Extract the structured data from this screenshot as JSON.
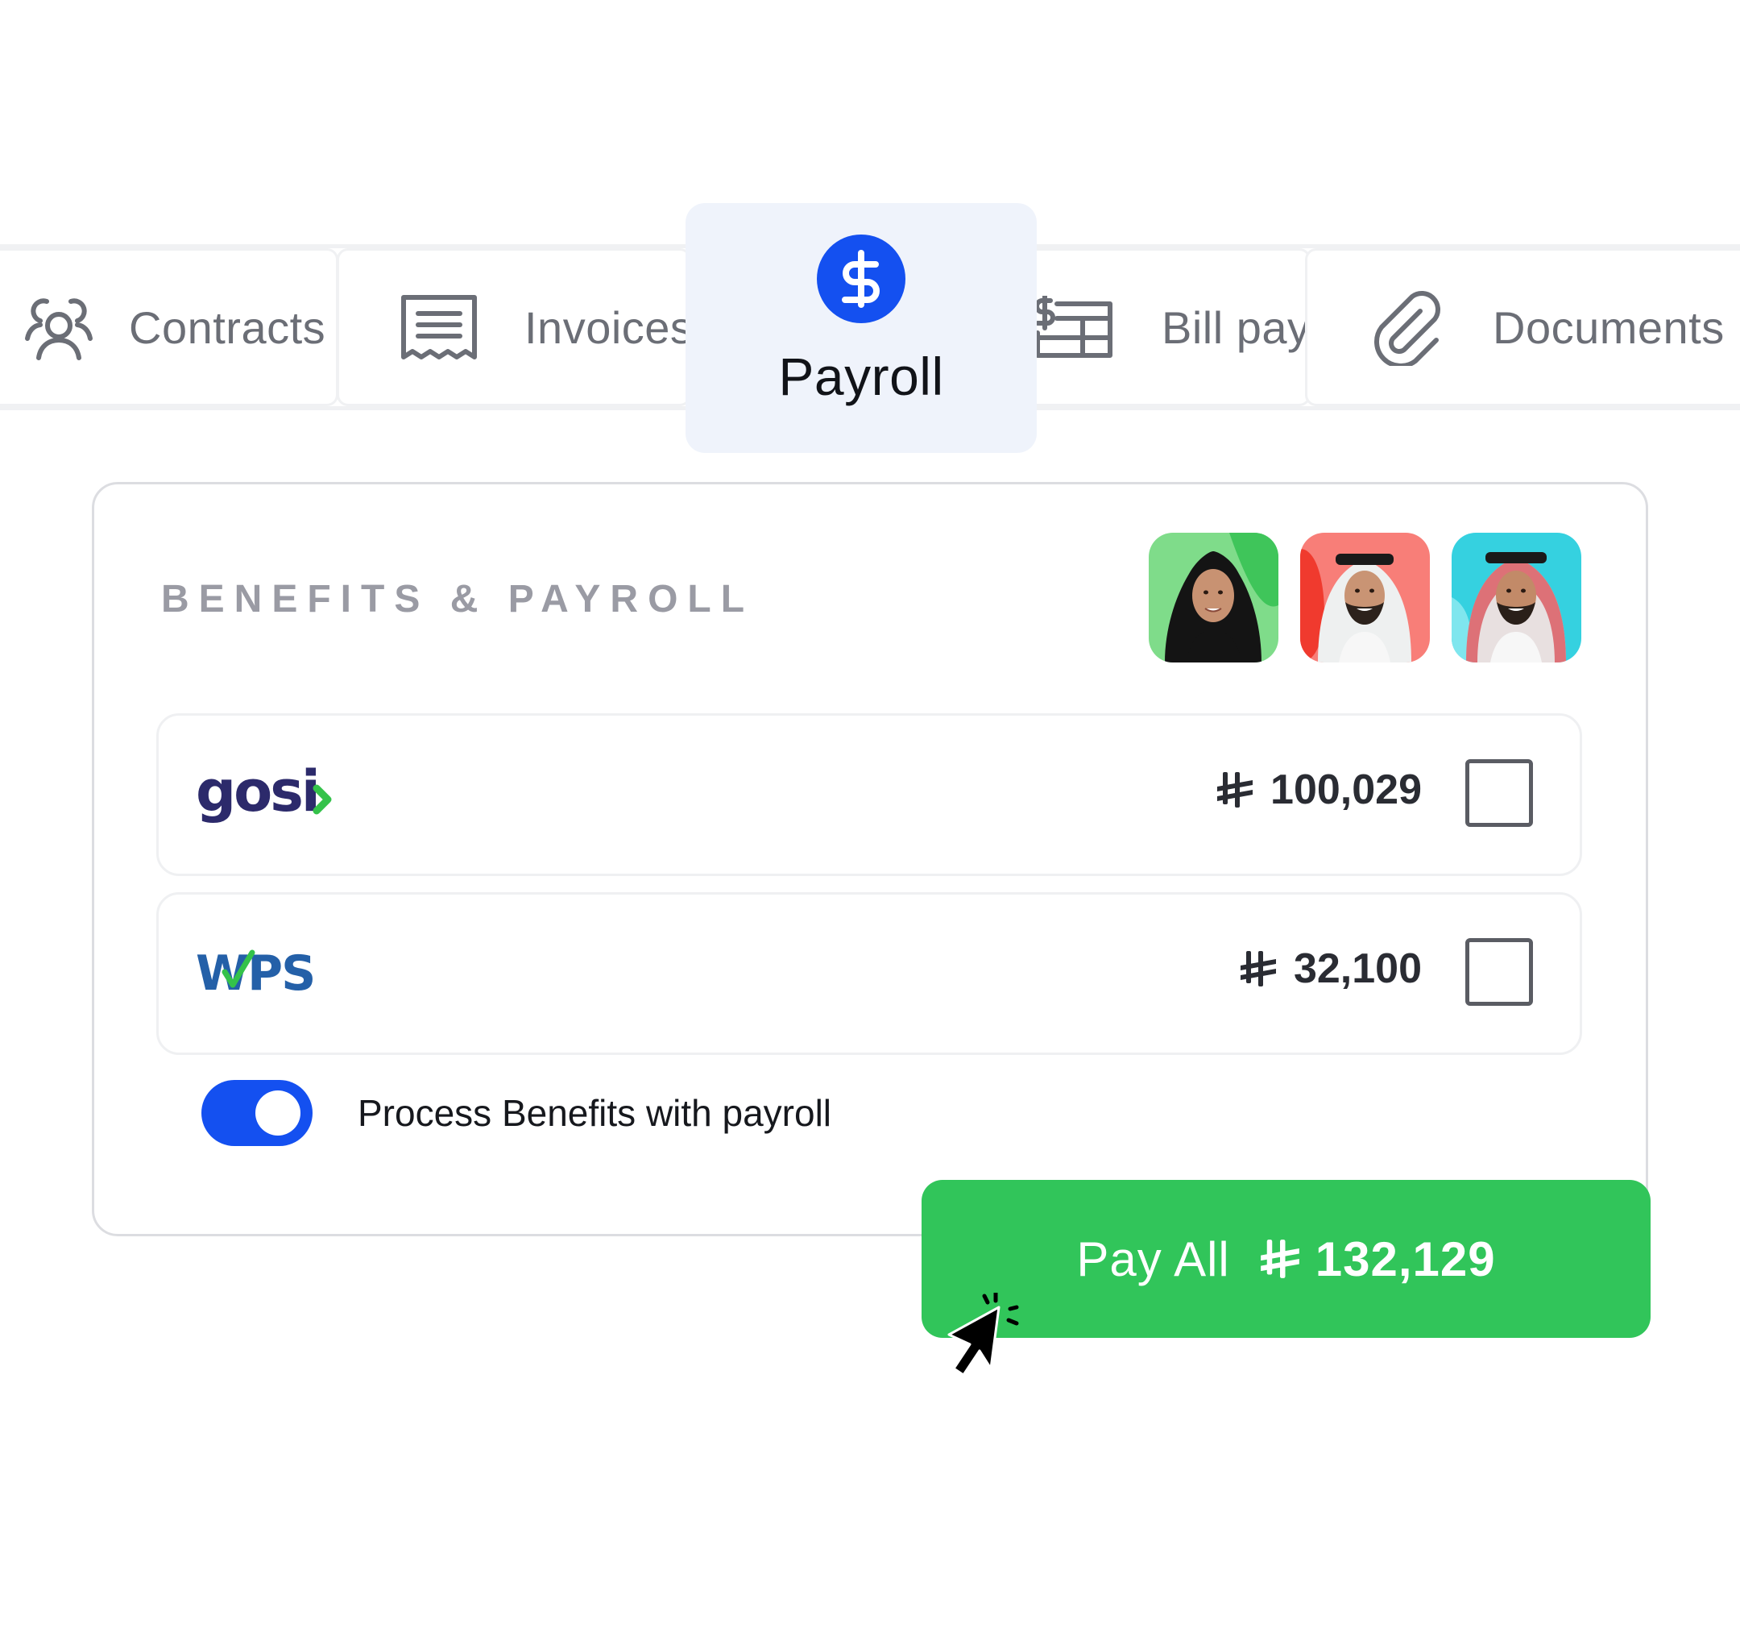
{
  "tabs": {
    "contracts": {
      "label": "Contracts",
      "icon": "users-icon"
    },
    "invoices": {
      "label": "Invoices",
      "icon": "receipt-icon"
    },
    "payroll": {
      "label": "Payroll",
      "icon": "dollar-icon",
      "active": true
    },
    "bill_pay": {
      "label": "Bill pay",
      "icon": "bill-list-icon"
    },
    "documents": {
      "label": "Documents",
      "icon": "paperclip-icon"
    }
  },
  "card": {
    "title": "BENEFITS & PAYROLL",
    "avatars": [
      {
        "name": "employee-avatar-1",
        "bg": "#7fdc8a"
      },
      {
        "name": "employee-avatar-2",
        "bg": "#f87e78"
      },
      {
        "name": "employee-avatar-3",
        "bg": "#35d1e0"
      }
    ],
    "rows": [
      {
        "provider": "gosi",
        "logo_text": "gosi",
        "currency_symbol": "⃁",
        "amount": "100,029",
        "checked": false
      },
      {
        "provider": "wps",
        "logo_text": "WPS",
        "currency_symbol": "⃁",
        "amount": "32,100",
        "checked": false
      }
    ],
    "toggle": {
      "label": "Process Benefits with payroll",
      "on": true
    }
  },
  "pay_button": {
    "label": "Pay All",
    "amount": "132,129"
  },
  "colors": {
    "accent_blue": "#1450f0",
    "pay_green": "#31c55a",
    "gosi_navy": "#2c2a6b",
    "gosi_green": "#34c24a",
    "wps_blue": "#2460a8"
  }
}
